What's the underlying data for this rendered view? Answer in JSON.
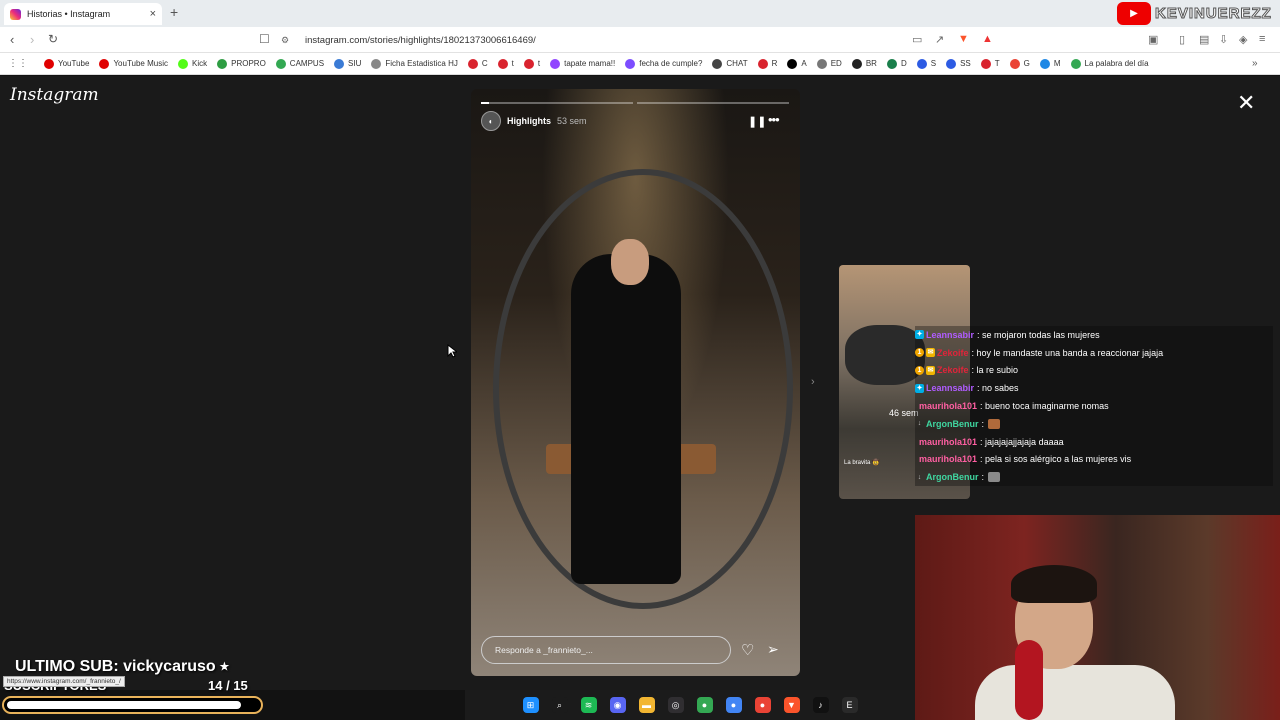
{
  "browser": {
    "tab_title": "Historias • Instagram",
    "tab_close": "×",
    "new_tab": "+",
    "url": "instagram.com/stories/highlights/18021373006616469/",
    "channel_name": "KEVINUEREZZ"
  },
  "bookmarks": [
    {
      "label": "YouTube",
      "color": "#e00000"
    },
    {
      "label": "YouTube Music",
      "color": "#e00000"
    },
    {
      "label": "Kick",
      "color": "#53fc18"
    },
    {
      "label": "PROPRO",
      "color": "#2e9d43"
    },
    {
      "label": "CAMPUS",
      "color": "#33a852"
    },
    {
      "label": "SIU",
      "color": "#3a7bd5"
    },
    {
      "label": "Ficha Estadistica HJ",
      "color": "#888888"
    },
    {
      "label": "C",
      "color": "#d9232e"
    },
    {
      "label": "t",
      "color": "#d9232e"
    },
    {
      "label": "t",
      "color": "#d9232e"
    },
    {
      "label": "tapate mama!!",
      "color": "#9146ff"
    },
    {
      "label": "fecha de cumple?",
      "color": "#7c4dff"
    },
    {
      "label": "CHAT",
      "color": "#444444"
    },
    {
      "label": "R",
      "color": "#d9232e"
    },
    {
      "label": "A",
      "color": "#000000"
    },
    {
      "label": "ED",
      "color": "#777777"
    },
    {
      "label": "BR",
      "color": "#222222"
    },
    {
      "label": "D",
      "color": "#1a7f4b"
    },
    {
      "label": "S",
      "color": "#2d5be3"
    },
    {
      "label": "SS",
      "color": "#2d5be3"
    },
    {
      "label": "T",
      "color": "#d9232e"
    },
    {
      "label": "G",
      "color": "#ea4335"
    },
    {
      "label": "M",
      "color": "#1e88e5"
    },
    {
      "label": "La palabra del día",
      "color": "#34a853"
    }
  ],
  "instagram": {
    "logo": "Instagram",
    "close": "✕",
    "story": {
      "title": "Highlights",
      "time": "53 sem",
      "reply_placeholder": "Responde a _frannieto_...",
      "progress_fraction": 0.05
    },
    "preview": {
      "time": "46 sem",
      "caption": "La bravita 🤠"
    }
  },
  "chat": [
    {
      "user": "Leannsabir",
      "color": "#b05cff",
      "badges": [
        "twitch"
      ],
      "message": ": se mojaron todas las mujeres"
    },
    {
      "user": "Zekoife",
      "color": "#e0243a",
      "badges": [
        "1",
        "sub"
      ],
      "message": ": hoy le mandaste una banda a reaccionar jajaja"
    },
    {
      "user": "Zekoife",
      "color": "#e0243a",
      "badges": [
        "1",
        "sub"
      ],
      "message": ": la re subio"
    },
    {
      "user": "Leannsabir",
      "color": "#b05cff",
      "badges": [
        "twitch"
      ],
      "message": ": no sabes"
    },
    {
      "user": "maurihola101",
      "color": "#ff5fa2",
      "badges": [],
      "message": ": bueno toca imaginarme nomas"
    },
    {
      "user": "ArgonBenur",
      "color": "#3fd6a0",
      "badges": [
        "mod"
      ],
      "message": " :",
      "emote": "#b06a3b"
    },
    {
      "user": "maurihola101",
      "color": "#ff5fa2",
      "badges": [],
      "message": ": jajajajajjajaja daaaa"
    },
    {
      "user": "maurihola101",
      "color": "#ff5fa2",
      "badges": [],
      "message": ": pela si sos alérgico a las mujeres vis"
    },
    {
      "user": "ArgonBenur",
      "color": "#3fd6a0",
      "badges": [
        "mod"
      ],
      "message": " :",
      "emote": "#8a8a8a"
    }
  ],
  "overlay": {
    "last_sub": "ULTIMO SUB: vickycaruso ⭑",
    "subs_title": "SUSCRIPTORES",
    "subs_count": "14  / 15",
    "subs_fraction": 0.933,
    "tooltip": "https://www.instagram.com/_frannieto_/"
  },
  "taskbar": [
    {
      "name": "windows-start-icon",
      "color": "#1e90ff",
      "glyph": "⊞"
    },
    {
      "name": "search-icon",
      "color": "#1b1b1b",
      "glyph": "⌕"
    },
    {
      "name": "spotify-icon",
      "color": "#1db954",
      "glyph": "≋"
    },
    {
      "name": "discord-icon",
      "color": "#5865f2",
      "glyph": "◉"
    },
    {
      "name": "file-explorer-icon",
      "color": "#f2b632",
      "glyph": "▬"
    },
    {
      "name": "obs-icon",
      "color": "#302e31",
      "glyph": "◎"
    },
    {
      "name": "chrome-icon",
      "color": "#34a853",
      "glyph": "●"
    },
    {
      "name": "chrome-alt-icon",
      "color": "#4285f4",
      "glyph": "●"
    },
    {
      "name": "chrome-alt2-icon",
      "color": "#ea4335",
      "glyph": "●"
    },
    {
      "name": "brave-icon",
      "color": "#fb542b",
      "glyph": "▼"
    },
    {
      "name": "tiktok-icon",
      "color": "#111111",
      "glyph": "♪"
    },
    {
      "name": "epic-games-icon",
      "color": "#2a2a2a",
      "glyph": "E"
    }
  ]
}
